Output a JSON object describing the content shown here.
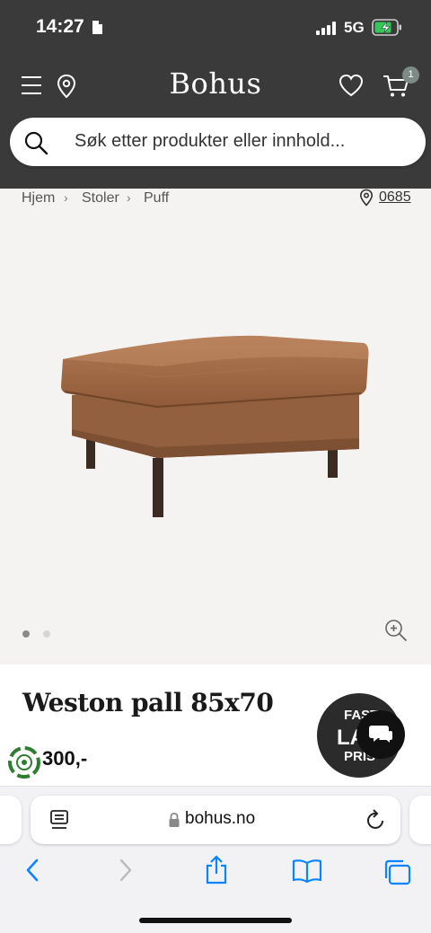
{
  "status_bar": {
    "time": "14:27",
    "network": "5G"
  },
  "header": {
    "brand": "Bohus",
    "cart_count": "1"
  },
  "search": {
    "placeholder": "Søk etter produkter eller innhold..."
  },
  "breadcrumb": {
    "items": [
      "Hjem",
      "Stoler",
      "Puff"
    ],
    "store": "0685"
  },
  "gallery": {
    "image_count": 2,
    "active_index": 0
  },
  "product": {
    "title": "Weston pall 85x70",
    "price_fragment": "300,-"
  },
  "promo": {
    "line1": "FAST",
    "line2": "LAV",
    "line3": "PRIS"
  },
  "browser": {
    "url": "bohus.no"
  },
  "colors": {
    "header_bg": "#3a3a3a",
    "page_bg": "#f4f3f2",
    "accent_green": "#2e7d32",
    "badge": "#7d8a86",
    "link_blue": "#0a84ff"
  }
}
